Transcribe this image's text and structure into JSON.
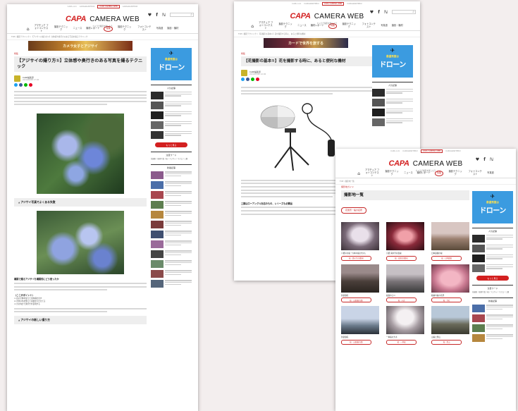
{
  "site": {
    "brand_capa": "CAPA",
    "brand_camera_web": "CAMERA WEB",
    "tagline": "カメラで撮影を楽しもう",
    "top_links": [
      "CAPA.com",
      "CAPAGRANTPRIX",
      "CAPA CAMERA WEB",
      "CAPAGRANTPRIX"
    ],
    "social": "♥ f ℕ",
    "nav": [
      "アマチュア フォトコンテスト",
      "撮影テクニック",
      "ニュース",
      "機材レポート",
      "特集",
      "撮影テクニック",
      "フォトコンテスト",
      "写真道",
      "撮影・機材"
    ],
    "nav_active_index": 4
  },
  "article1": {
    "breadcrumb": "TOP / 撮影テクニック / 【アジサイの撮り方①】立体感や奥行きのある写真を撮るテクニック",
    "banner": "カメラ女子とアジサイ",
    "category": "特集",
    "title": "【アジサイの撮り方①】立体感や奥行きのある写真を撮るテクニック",
    "author": "CAPA編集部",
    "date": "2020/06/08 17:00",
    "section1": "アジサイ写真でよくある失敗",
    "bold1": "構図で撮るアジサイを構図的にどう使ったか",
    "list_head": "〈ここがポイント〉",
    "list": [
      "① 花の全体を捉えて立体感を出す",
      "② 背景の色を整えて主題を引き立てる",
      "③ 光の向きで奥行きを表現する"
    ],
    "section2": "アジサイの新しい撮り方"
  },
  "article2": {
    "breadcrumb": "TOP / 撮影テクニック / 【花撮影の基本①】花を撮影する時に、あると便利な機材",
    "banner": "カードで世界を旅する",
    "category": "特集",
    "title": "【花撮影の基本①】花を撮影する時に、あると便利な機材",
    "author": "CAPA編集部",
    "date": "2020/03/20 12:00",
    "bold1": "三脚はローアングル対応のもの、レリーズも必需品"
  },
  "gallery": {
    "breadcrumb": "TOP / 撮影地一覧",
    "category": "撮影地ガイド",
    "title": "撮影地一覧",
    "filter": "花風景・桜の名所",
    "items": [
      {
        "caption": "八幡平の桜「六本木桜の大木」",
        "tag": "桜・清水寺(京都府)"
      },
      {
        "caption": "京都 清水寺の夜桜",
        "tag": "桜・夜景(京都府)"
      },
      {
        "caption": "日本庭園の桜",
        "tag": "桜・日本庭園"
      },
      {
        "caption": "新宿御苑",
        "tag": "桜・公園(東京都)"
      },
      {
        "caption": "桜並木と川",
        "tag": "桜・川辺"
      },
      {
        "caption": "枝垂れ桜の名所",
        "tag": "桜・寺社"
      },
      {
        "caption": "新宿御苑",
        "tag": "桜・公園(東京都)"
      },
      {
        "caption": "一本桜の大木",
        "tag": "桜・一本桜"
      },
      {
        "caption": "山桜と里山",
        "tag": "桜・里山"
      }
    ]
  },
  "sidebar": {
    "ad_small": "最優秀賞は",
    "ad_big": "ドローン",
    "heading_ranking": "人気記事",
    "heading_keywords": "注目ワード",
    "heading_new": "新着記事",
    "more_button": "もっと見る",
    "keywords": "花撮影 / 風景写真 / 桜 / アジサイ / マクロ / 三脚"
  },
  "colors": {
    "brand_red": "#d32020",
    "link_red": "#c62828",
    "ad_blue": "#3b9be0"
  }
}
